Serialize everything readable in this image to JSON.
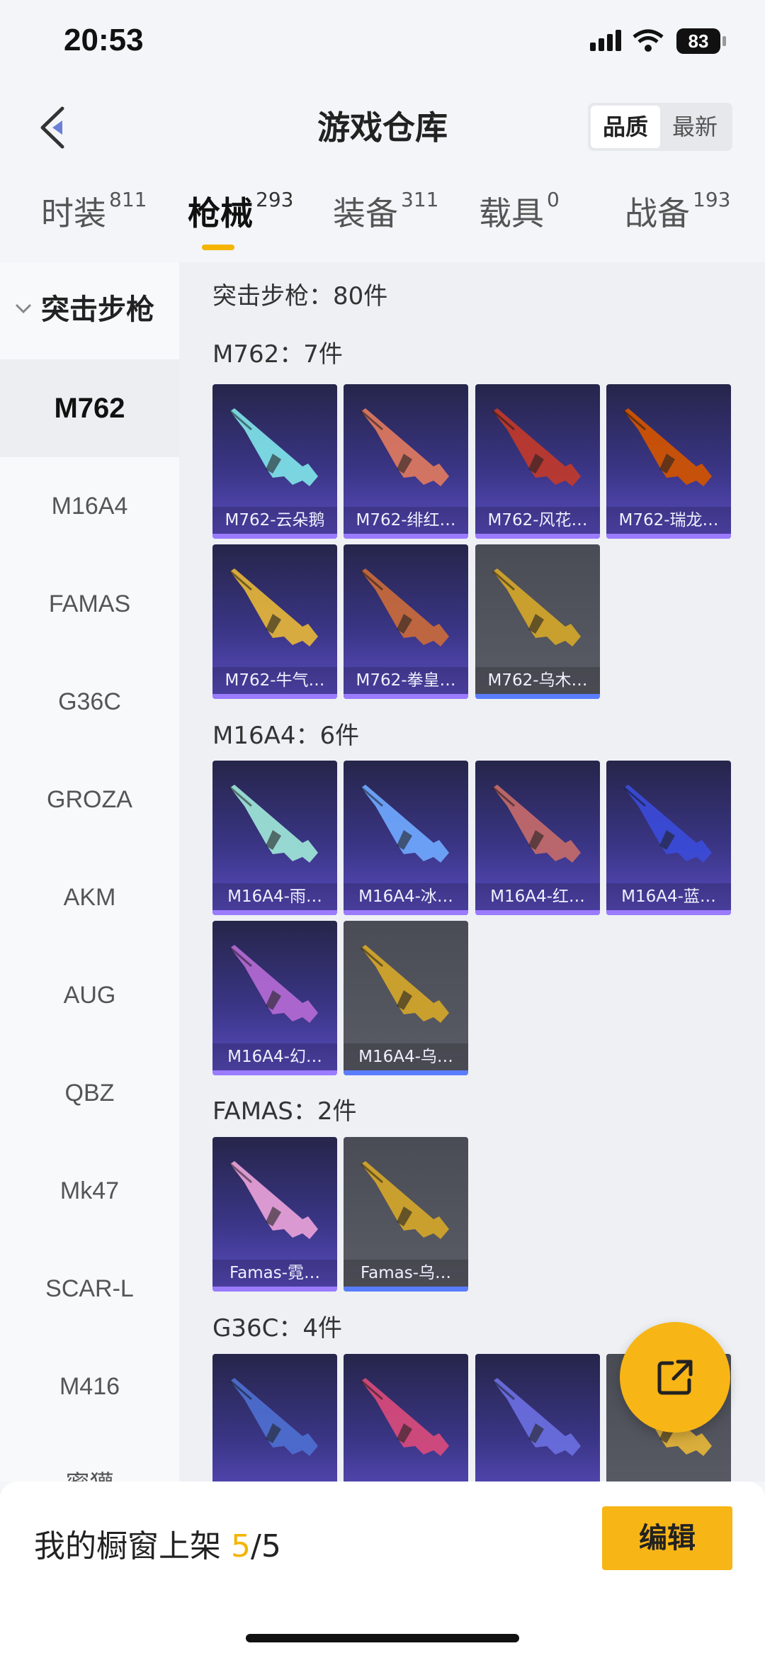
{
  "status": {
    "time": "20:53",
    "battery": "83"
  },
  "header": {
    "title": "游戏仓库",
    "sort_quality": "品质",
    "sort_latest": "最新"
  },
  "tabs": [
    {
      "label": "时装",
      "count": "811"
    },
    {
      "label": "枪械",
      "count": "293"
    },
    {
      "label": "装备",
      "count": "311"
    },
    {
      "label": "载具",
      "count": "0"
    },
    {
      "label": "战备",
      "count": "193"
    }
  ],
  "sidebar": {
    "category": "突击步枪",
    "items": [
      "M762",
      "M16A4",
      "FAMAS",
      "G36C",
      "GROZA",
      "AKM",
      "AUG",
      "QBZ",
      "Mk47",
      "SCAR-L",
      "M416",
      "蜜獾"
    ]
  },
  "main": {
    "total": "突击步枪：80件",
    "groups": [
      {
        "title": "M762：7件",
        "items": [
          "M762-云朵鹅",
          "M762-绯红…",
          "M762-风花…",
          "M762-瑞龙…",
          "M762-牛气…",
          "M762-拳皇…",
          "M762-乌木…"
        ]
      },
      {
        "title": "M16A4：6件",
        "items": [
          "M16A4-雨…",
          "M16A4-冰…",
          "M16A4-红…",
          "M16A4-蓝…",
          "M16A4-幻…",
          "M16A4-乌…"
        ]
      },
      {
        "title": "FAMAS：2件",
        "items": [
          "Famas-霓…",
          "Famas-乌…"
        ]
      },
      {
        "title": "G36C：4件",
        "items": [
          "",
          "",
          "",
          ""
        ]
      }
    ]
  },
  "bottom": {
    "label": "我的橱窗上架",
    "current": "5",
    "total": "/5",
    "edit": "编辑"
  },
  "colors": {
    "accent": "#f7b516",
    "purple_card": "#3a3585",
    "gray_card": "#55575f"
  }
}
